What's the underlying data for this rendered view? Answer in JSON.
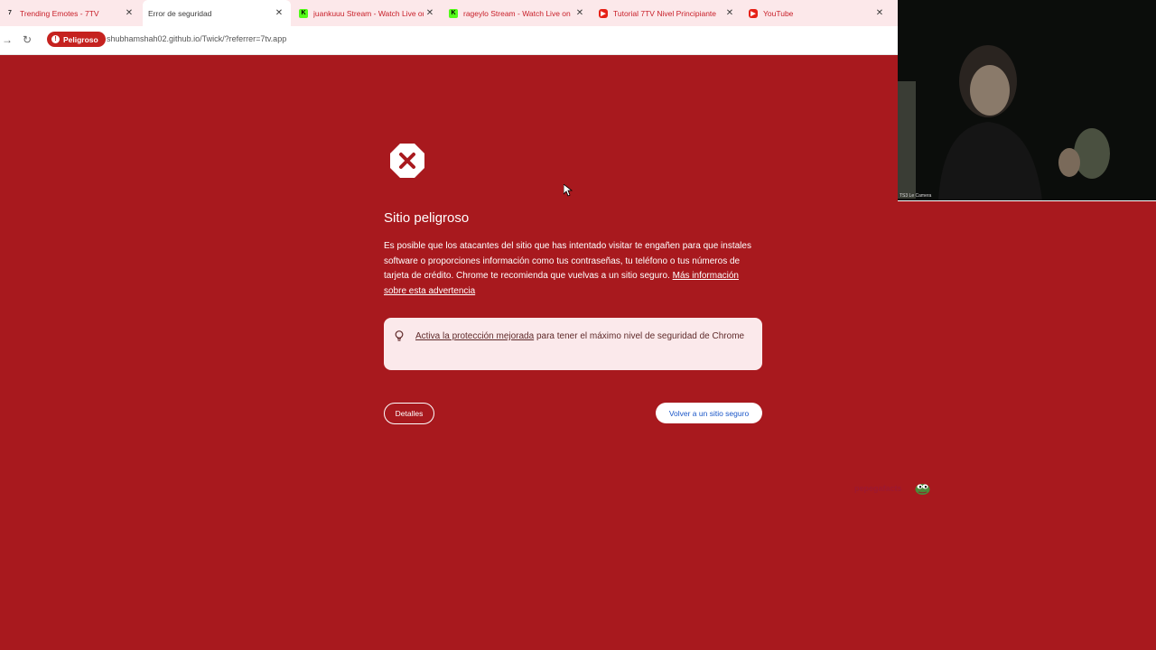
{
  "browser": {
    "tabs": [
      {
        "title": "Trending Emotes - 7TV",
        "icon": "7tv-icon",
        "active": false
      },
      {
        "title": "Error de seguridad",
        "icon": "none",
        "active": true
      },
      {
        "title": "juankuuu Stream - Watch Live on",
        "icon": "kick-icon",
        "active": false
      },
      {
        "title": "rageylo Stream - Watch Live on",
        "icon": "kick-icon",
        "active": false
      },
      {
        "title": "Tutorial 7TV Nivel Principiante",
        "icon": "youtube-icon",
        "active": false
      },
      {
        "title": "YouTube",
        "icon": "youtube-icon",
        "active": false
      }
    ],
    "close_glyph": "✕",
    "security_chip": "Peligroso",
    "url": "shubhamshah02.github.io/Twick/?referrer=7tv.app"
  },
  "page": {
    "title": "Sitio peligroso",
    "body_text": "Es posible que los atacantes del sitio que has intentado visitar te engañen para que instales software o proporciones información como tus contraseñas, tu teléfono o tus números de tarjeta de crédito. Chrome te recomienda que vuelvas a un sitio seguro.",
    "more_info_link": "Más información sobre esta advertencia",
    "tip_link": "Activa la protección mejorada",
    "tip_text": "para tener el máximo nivel de seguridad de Chrome",
    "details_button": "Detalles",
    "back_button": "Volver a un sitio seguro"
  },
  "overlay": {
    "webcam_label": "TS3 Le Camera",
    "emote_text": "pepegafacts"
  },
  "colors": {
    "danger_background": "#a8191e",
    "chip": "#c5221f",
    "link_blue": "#1a56c8",
    "tip_background": "#fbe9eb"
  }
}
